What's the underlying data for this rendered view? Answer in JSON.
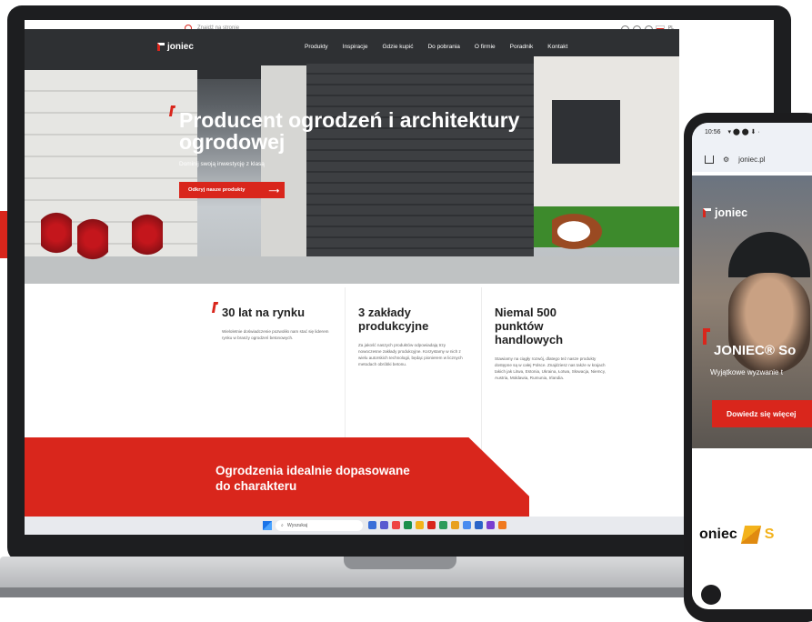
{
  "site": {
    "search_placeholder": "Znajdź na stronie",
    "lang": "PL",
    "logo": "joniec",
    "nav": [
      "Produkty",
      "Inspiracje",
      "Gdzie kupić",
      "Do pobrania",
      "O firmie",
      "Poradnik",
      "Kontakt"
    ]
  },
  "hero": {
    "title": "Producent ogrodzeń i architektury ogrodowej",
    "subtitle": "Dominij swoją inwestycję z klasą",
    "cta": "Odkryj nasze produkty",
    "cta_arrow": "⟶"
  },
  "stats": [
    {
      "title": "30 lat na rynku",
      "text": "Wieloletnie doświadczenie pozwoliło nam stać się liderem rynku w branży ogrodzeń betonowych."
    },
    {
      "title": "3 zakłady produkcyjne",
      "text": "Za jakość naszych produktów odpowiadają trzy nowoczesne zakłady produkcyjne. Korzystamy w nich z wielu autorskich technologii, będąc pionierem w licznych metodach obróbki betonu."
    },
    {
      "title": "Niemal 500 punktów handlowych",
      "text": "Stawiamy na ciągły rozwój, dlatego też nasze produkty dostępne są w całej Polsce. Znajdziesz nas także w krajach takich jak Litwa, Estonia, Ukraina, Łotwa, Słowacja, Niemcy, Austria, Mołdawia, Rumunia, Irlandia."
    }
  ],
  "banner": {
    "title": "Ogrodzenia idealnie dopasowane do charakteru"
  },
  "taskbar": {
    "search": "Wyszukaj"
  },
  "phone": {
    "time": "10:56",
    "status_icons": "▾ ⬤ ⬤ ⬇ ·",
    "url": "joniec.pl",
    "logo": "joniec",
    "title": "JONIEC® So",
    "subtitle": "Wyjątkowe wyzwanie t",
    "cta": "Dowiedz się więcej",
    "brand": "oniec",
    "brand2": "S"
  },
  "colors": {
    "accent": "#d9261c",
    "dark": "#1d1e20"
  }
}
